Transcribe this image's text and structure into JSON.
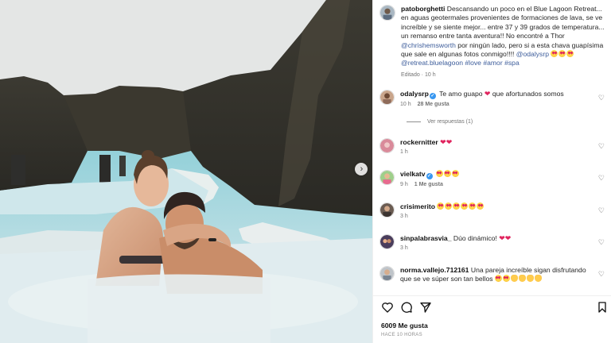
{
  "post": {
    "image_alt": "Couple relaxing in the Blue Lagoon geothermal waters",
    "author": "patoborghetti",
    "caption_main": "Descansando un poco en el Blue Lagoon Retreat... en aguas geotermales provenientes de formaciones de lava, se ve increíble y se siente mejor... entre 37 y 39 grados de temperatura... un remanso entre tanta aventura!! No encontré a Thor",
    "mention_thor": "@chrishemsworth",
    "caption_mid": "por ningún lado, pero si a esta chava guapísima que sale en algunas fotos conmigo!!!!",
    "mention_partner": "@odalysrp",
    "mention_place": "@retreat.bluelagoon",
    "hashtags": "#love #amor #spa",
    "edited": "Editado · 10 h",
    "likes": "6009 Me gusta",
    "time_ago": "HACE 10 HORAS"
  },
  "comments": [
    {
      "user": "odalysrp",
      "verified": true,
      "text_a": "Te amo guapo",
      "text_b": "que afortunados somos",
      "time": "10 h",
      "likes": "28 Me gusta"
    },
    {
      "user": "rockernitter",
      "text_a": "",
      "time": "1 h",
      "likes": ""
    },
    {
      "user": "vielkatv",
      "verified": true,
      "text_a": "",
      "time": "9 h",
      "likes": "1 Me gusta"
    },
    {
      "user": "crisimerito",
      "text_a": "",
      "time": "3 h",
      "likes": ""
    },
    {
      "user": "sinpalabrasvia_",
      "text_a": "Dúo dinámico!",
      "time": "3 h",
      "likes": ""
    },
    {
      "user": "norma.vallejo.712161",
      "text_a": "Una pareja increíble sigan disfrutando que se ve súper son tan bellos",
      "time": "",
      "likes": ""
    }
  ],
  "replies_label": "Ver respuestas (1)",
  "icons": {
    "like": "heart-outline-icon",
    "comment": "comment-bubble-icon",
    "share": "paper-plane-icon",
    "save": "bookmark-icon",
    "next": "chevron-right-icon"
  },
  "colors": {
    "accent_link": "#3d5d9b",
    "heart": "#e0245e",
    "verified": "#3897f0",
    "water": "#9fd0d7"
  }
}
